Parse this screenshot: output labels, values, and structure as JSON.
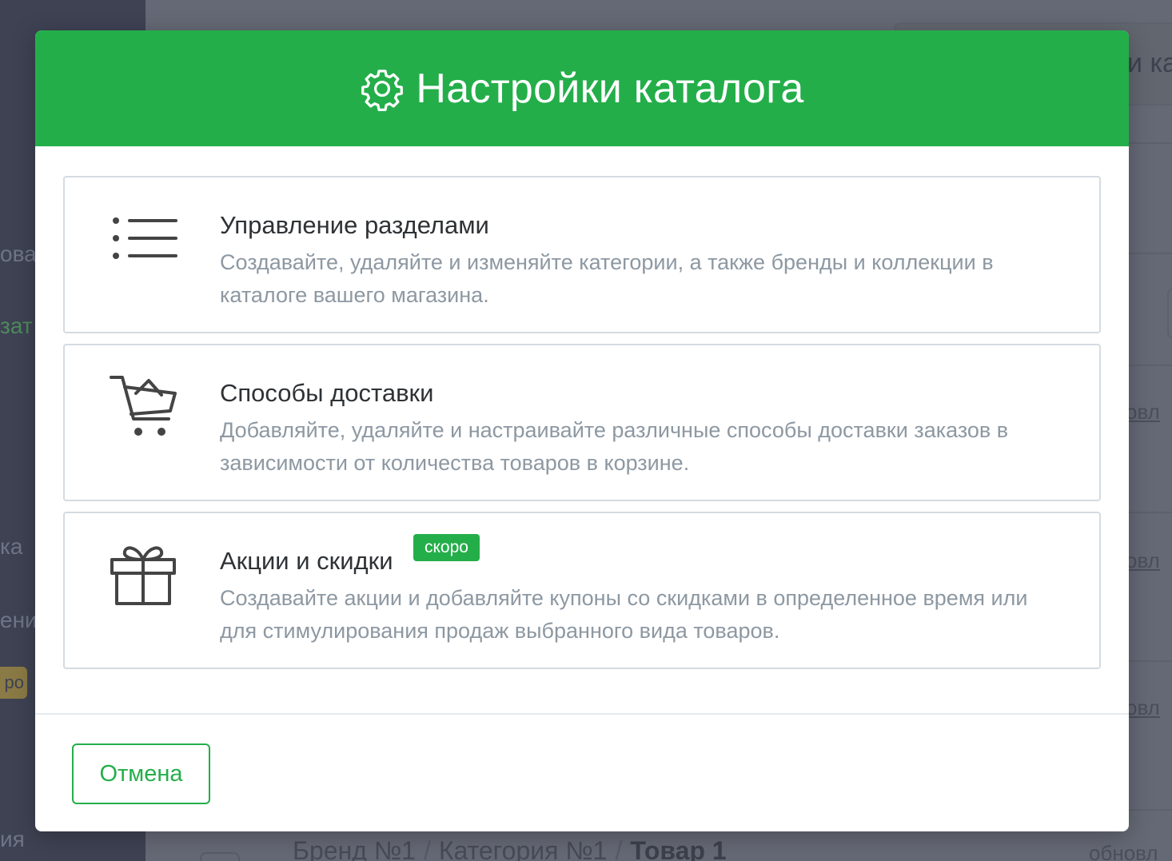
{
  "background": {
    "sidebar_fragments": [
      "ова",
      "зат",
      "ка",
      "ени",
      "ия"
    ],
    "sidebar_badge": "ро",
    "header_fragment": "и ка",
    "row_links": [
      "овл",
      "овл",
      "овл",
      "обновл"
    ],
    "breadcrumb": {
      "brand": "Бренд №1",
      "category": "Категория №1",
      "product": "Товар 1",
      "separator": "/"
    }
  },
  "modal": {
    "title": "Настройки каталога",
    "title_icon": "gear-icon",
    "header_color": "#24ae4a",
    "items": [
      {
        "icon": "list-icon",
        "title": "Управление разделами",
        "description": "Создавайте, удаляйте и изменяйте категории, а также бренды и коллекции в каталоге вашего магазина."
      },
      {
        "icon": "cart-icon",
        "title": "Способы доставки",
        "description": "Добавляйте, удаляйте и настраивайте различные способы доставки заказов в зависимости от количества товаров в корзине."
      },
      {
        "icon": "gift-icon",
        "title": "Акции и скидки",
        "badge": "скоро",
        "description": "Создавайте акции и добавляйте купоны со скидками в определенное время или для стимулирования продаж выбранного вида товаров."
      }
    ],
    "cancel_label": "Отмена"
  }
}
